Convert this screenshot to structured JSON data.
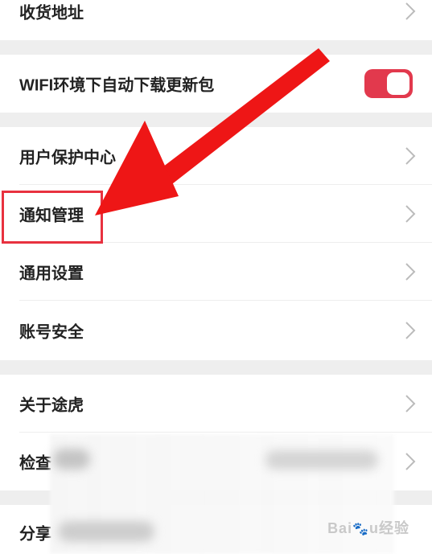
{
  "rows": {
    "address": "收货地址",
    "wifi": "WIFI环境下自动下载更新包",
    "protection": "用户保护中心",
    "notification": "通知管理",
    "general": "通用设置",
    "account": "账号安全",
    "about": "关于途虎",
    "check": "检查",
    "share": "分享"
  },
  "wifi_toggle_on": true,
  "icons": {
    "chevron": "chevron-right-icon",
    "toggle": "toggle-switch"
  },
  "colors": {
    "accent": "#e2394d",
    "highlight": "#e8313f"
  },
  "watermark": {
    "brand": "Bai",
    "brand2": "u",
    "suffix": "经验"
  }
}
